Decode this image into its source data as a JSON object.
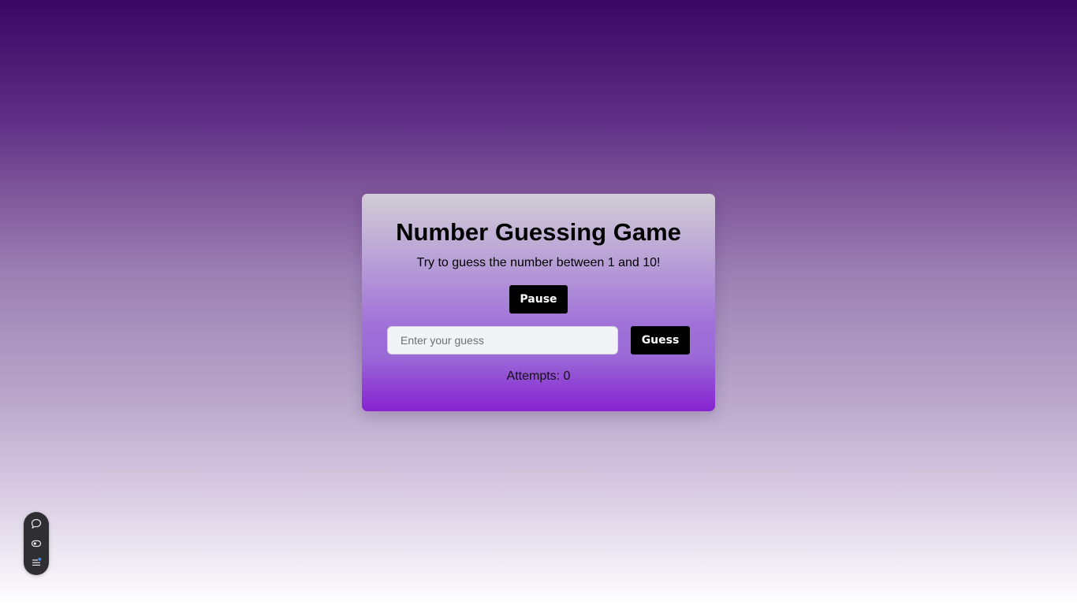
{
  "game": {
    "title": "Number Guessing Game",
    "subtitle": "Try to guess the number between 1 and 10!",
    "pause_label": "Pause",
    "guess_placeholder": "Enter your guess",
    "guess_value": "",
    "guess_label": "Guess",
    "attempts_text": "Attempts: 0"
  },
  "toolbar": {
    "items": [
      {
        "icon": "chat-bubble-icon"
      },
      {
        "icon": "eye-toggle-icon"
      },
      {
        "icon": "list-menu-icon"
      }
    ]
  },
  "colors": {
    "card_top": "#d1cdd6",
    "card_bottom": "#8622d1",
    "button_bg": "#000000",
    "background_top": "#3a0864",
    "notification_dot": "#3b8cff"
  }
}
